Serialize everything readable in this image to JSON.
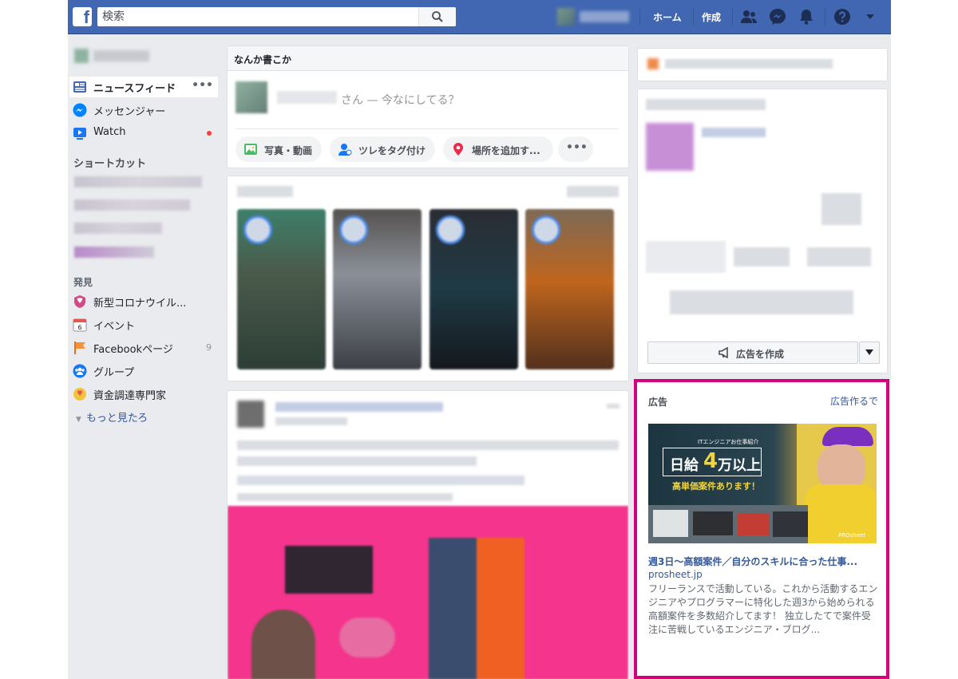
{
  "topbar": {
    "logo_letter": "f",
    "search_placeholder": "検索",
    "nav_home": "ホーム",
    "nav_create": "作成"
  },
  "left_nav": {
    "items": [
      {
        "label": "ニュースフィード",
        "icon": "newsfeed-icon",
        "active": true
      },
      {
        "label": "メッセンジャー",
        "icon": "messenger-icon"
      },
      {
        "label": "Watch",
        "icon": "watch-icon",
        "notify": true
      }
    ],
    "shortcuts_title": "ショートカット",
    "explore_title": "発見",
    "explore_items": [
      {
        "label": "新型コロナウイル...",
        "icon": "coronavirus-shield-icon"
      },
      {
        "label": "イベント",
        "icon": "calendar-icon",
        "day": "6"
      },
      {
        "label": "Facebookページ",
        "icon": "flag-icon",
        "count": "9"
      },
      {
        "label": "グループ",
        "icon": "groups-icon"
      },
      {
        "label": "資金調達専門家",
        "icon": "coin-icon"
      }
    ],
    "more_link": "もっと見たろ"
  },
  "composer": {
    "header": "なんか書こか",
    "prompt": "さん — 今なにしてる？",
    "actions": [
      {
        "label": "写真・動画",
        "icon": "photo-icon"
      },
      {
        "label": "ツレをタグ付け",
        "icon": "tag-friend-icon"
      },
      {
        "label": "場所を追加す...",
        "icon": "location-pin-icon"
      }
    ],
    "more": "•••"
  },
  "right": {
    "create_ad_label": "広告を作成"
  },
  "sponsored": {
    "header": "広告",
    "create_link": "広告作るで",
    "image": {
      "caption_small": "ITエンジニアお仕事紹介",
      "headline": "日給",
      "headline_num": "4",
      "headline_rest": "万以上",
      "subline": "高単価案件あります！",
      "brand": "PROsheet"
    },
    "title": "週3日〜高額案件／自分のスキルに合った仕事...",
    "domain": "prosheet.jp",
    "body": "フリーランスで活動している。これから活動するエンジニアやプログラマーに特化した週3から始められる高額案件を多数紹介してます！ 独立したてで案件受注に苦戦しているエンジニア・ブログ..."
  },
  "colors": {
    "brand_blue": "#4267b2",
    "link_blue": "#365899",
    "highlight_border": "#d6007f",
    "notify_red": "#fa3e3e"
  }
}
